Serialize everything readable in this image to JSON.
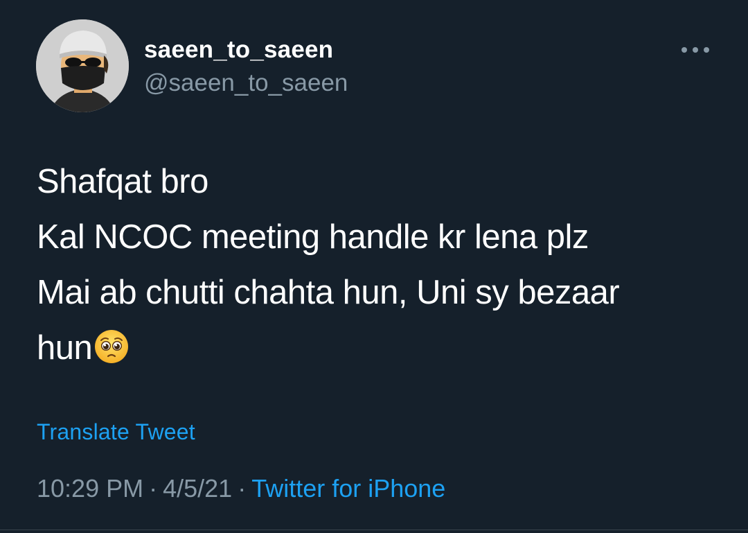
{
  "user": {
    "display_name": "saeen_to_saeen",
    "handle": "@saeen_to_saeen"
  },
  "tweet": {
    "lines": [
      "Shafqat bro",
      "Kal NCOC meeting handle kr lena plz",
      "Mai ab chutti chahta hun, Uni sy bezaar",
      "hun"
    ],
    "emoji": "pleading-face",
    "translate_label": "Translate Tweet",
    "time": "10:29 PM",
    "separator": "·",
    "date": "4/5/21",
    "source": "Twitter for iPhone"
  },
  "icons": {
    "more": "more-options-icon",
    "avatar": "avatar"
  },
  "colors": {
    "background": "#15202b",
    "text": "#ffffff",
    "secondary": "#8899a6",
    "link": "#1da1f2"
  }
}
